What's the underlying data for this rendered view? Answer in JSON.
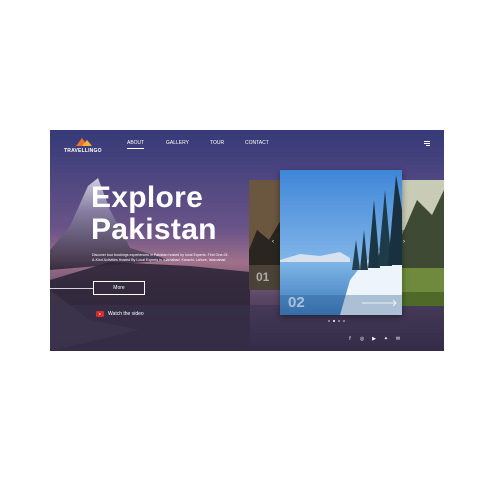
{
  "brand": {
    "name": "TRAVELLINGO"
  },
  "nav": {
    "items": [
      {
        "label": "ABOUT",
        "active": true
      },
      {
        "label": "GALLERY",
        "active": false
      },
      {
        "label": "TOUR",
        "active": false
      },
      {
        "label": "CONTACT",
        "active": false
      }
    ]
  },
  "hero": {
    "title_line1": "Explore",
    "title_line2": "Pakistan",
    "description": "Discover tour bookings experiences in Pakistan hosted by local Experts. Find One-Of-A-Kind Activities Hosted By Local Experts in Islamabad, Karachi, Lahore, Islamabad",
    "more_label": "More",
    "watch_label": "Watch the video"
  },
  "slider": {
    "cards": [
      {
        "number": "01",
        "scene": "mountain-cliff"
      },
      {
        "number": "02",
        "scene": "snowy-forest-lake"
      },
      {
        "number": "",
        "scene": "green-valley"
      }
    ],
    "dots": 4,
    "active_dot": 1
  },
  "social": [
    "facebook-icon",
    "instagram-icon",
    "youtube-icon",
    "twitter-icon",
    "mail-icon"
  ],
  "colors": {
    "accent": "#e8732c",
    "youtube": "#e02a2a"
  }
}
